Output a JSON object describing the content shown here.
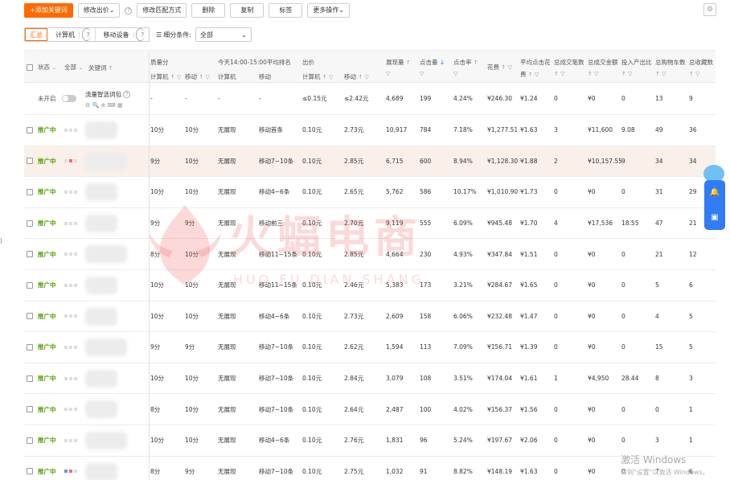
{
  "toolbar": {
    "add_keyword": "+添加关键词",
    "modify_bid": "修改出价",
    "modify_match": "修改匹配方式",
    "delete": "删除",
    "copy": "复制",
    "tag": "标签",
    "more": "更多操作"
  },
  "filters": {
    "segments": [
      "汇总",
      "计算机",
      "移动设备"
    ],
    "filter_label": "细分条件:",
    "filter_value": "全部"
  },
  "headers": {
    "status": "状态",
    "all": "全部",
    "keyword": "关键词",
    "quality_score": "质量分",
    "qs_pc": "计算机",
    "qs_mobile": "移动",
    "avg_rank_title": "今天14:00-15:00平均排名",
    "rank_pc": "计算机",
    "rank_mobile": "移动",
    "bid": "出价",
    "bid_pc": "计算机",
    "bid_mobile": "移动",
    "impressions": "展现量",
    "clicks": "点击量",
    "ctr": "点击率",
    "cost": "花费",
    "avg_cpc_1": "平均点击花",
    "avg_cpc_2": "费",
    "orders": "总成交笔数",
    "gmv": "总成交金额",
    "roi": "投入产出比",
    "cart": "总购物车数",
    "fav": "总收藏数"
  },
  "summary_row": {
    "status": "未开启",
    "keyword": "流量智选词包",
    "qs_pc": "-",
    "qs_mobile": "-",
    "rank_pc": "-",
    "rank_mobile": "-",
    "bid_pc": "≤0.15元",
    "bid_mobile": "≤2.42元",
    "impressions": "4,689",
    "clicks": "199",
    "ctr": "4.24%",
    "cost": "¥246.30",
    "avg_cpc": "¥1.24",
    "orders": "0",
    "gmv": "¥0",
    "roi": "0",
    "cart": "13",
    "fav": "9"
  },
  "rows": [
    {
      "status": "推广中",
      "qs_pc": "10分",
      "qs_mobile": "10分",
      "rank_pc": "无展现",
      "rank_mobile": "移动首条",
      "bid_pc": "0.10元",
      "bid_mobile": "2.73元",
      "impressions": "10,917",
      "clicks": "784",
      "ctr": "7.18%",
      "cost": "¥1,277.51",
      "avg_cpc": "¥1.63",
      "orders": "3",
      "gmv": "¥11,600",
      "roi": "9.08",
      "cart": "49",
      "fav": "36"
    },
    {
      "status": "推广中",
      "qs_pc": "9分",
      "qs_mobile": "10分",
      "rank_pc": "无展现",
      "rank_mobile": "移动7~10条",
      "bid_pc": "0.10元",
      "bid_mobile": "2.85元",
      "impressions": "6,715",
      "clicks": "600",
      "ctr": "8.94%",
      "cost": "¥1,128.30",
      "avg_cpc": "¥1.88",
      "orders": "2",
      "gmv": "¥10,157.55",
      "roi": "9",
      "cart": "34",
      "fav": "34"
    },
    {
      "status": "推广中",
      "qs_pc": "10分",
      "qs_mobile": "10分",
      "rank_pc": "无展现",
      "rank_mobile": "移动4~6条",
      "bid_pc": "0.10元",
      "bid_mobile": "2.65元",
      "impressions": "5,762",
      "clicks": "586",
      "ctr": "10.17%",
      "cost": "¥1,010.90",
      "avg_cpc": "¥1.73",
      "orders": "0",
      "gmv": "¥0",
      "roi": "0",
      "cart": "31",
      "fav": "29"
    },
    {
      "status": "推广中",
      "qs_pc": "9分",
      "qs_mobile": "9分",
      "rank_pc": "无展现",
      "rank_mobile": "移动前三",
      "bid_pc": "0.10元",
      "bid_mobile": "2.70元",
      "impressions": "9,119",
      "clicks": "555",
      "ctr": "6.09%",
      "cost": "¥945.48",
      "avg_cpc": "¥1.70",
      "orders": "4",
      "gmv": "¥17,536",
      "roi": "18.55",
      "cart": "47",
      "fav": "21"
    },
    {
      "status": "推广中",
      "qs_pc": "8分",
      "qs_mobile": "10分",
      "rank_pc": "无展现",
      "rank_mobile": "移动11~15条",
      "bid_pc": "0.10元",
      "bid_mobile": "2.85元",
      "impressions": "4,664",
      "clicks": "230",
      "ctr": "4.93%",
      "cost": "¥347.84",
      "avg_cpc": "¥1.51",
      "orders": "0",
      "gmv": "¥0",
      "roi": "0",
      "cart": "21",
      "fav": "12"
    },
    {
      "status": "推广中",
      "qs_pc": "10分",
      "qs_mobile": "10分",
      "rank_pc": "无展现",
      "rank_mobile": "移动11~15条",
      "bid_pc": "0.10元",
      "bid_mobile": "2.46元",
      "impressions": "5,383",
      "clicks": "173",
      "ctr": "3.21%",
      "cost": "¥284.67",
      "avg_cpc": "¥1.65",
      "orders": "0",
      "gmv": "¥0",
      "roi": "0",
      "cart": "5",
      "fav": "6"
    },
    {
      "status": "推广中",
      "qs_pc": "10分",
      "qs_mobile": "10分",
      "rank_pc": "无展现",
      "rank_mobile": "移动4~6条",
      "bid_pc": "0.10元",
      "bid_mobile": "2.73元",
      "impressions": "2,609",
      "clicks": "158",
      "ctr": "6.06%",
      "cost": "¥232.48",
      "avg_cpc": "¥1.47",
      "orders": "0",
      "gmv": "¥0",
      "roi": "0",
      "cart": "4",
      "fav": "5"
    },
    {
      "status": "推广中",
      "qs_pc": "9分",
      "qs_mobile": "9分",
      "rank_pc": "无展现",
      "rank_mobile": "移动7~10条",
      "bid_pc": "0.10元",
      "bid_mobile": "2.62元",
      "impressions": "1,594",
      "clicks": "113",
      "ctr": "7.09%",
      "cost": "¥156.71",
      "avg_cpc": "¥1.39",
      "orders": "0",
      "gmv": "¥0",
      "roi": "0",
      "cart": "15",
      "fav": "5"
    },
    {
      "status": "推广中",
      "qs_pc": "10分",
      "qs_mobile": "10分",
      "rank_pc": "无展现",
      "rank_mobile": "移动7~10条",
      "bid_pc": "0.10元",
      "bid_mobile": "2.84元",
      "impressions": "3,079",
      "clicks": "108",
      "ctr": "3.51%",
      "cost": "¥174.04",
      "avg_cpc": "¥1.61",
      "orders": "1",
      "gmv": "¥4,950",
      "roi": "28.44",
      "cart": "8",
      "fav": "3"
    },
    {
      "status": "推广中",
      "qs_pc": "8分",
      "qs_mobile": "10分",
      "rank_pc": "无展现",
      "rank_mobile": "移动7~10条",
      "bid_pc": "0.10元",
      "bid_mobile": "2.64元",
      "impressions": "2,487",
      "clicks": "100",
      "ctr": "4.02%",
      "cost": "¥156.37",
      "avg_cpc": "¥1.56",
      "orders": "0",
      "gmv": "¥0",
      "roi": "0",
      "cart": "0",
      "fav": "1"
    },
    {
      "status": "推广中",
      "qs_pc": "10分",
      "qs_mobile": "10分",
      "rank_pc": "无展现",
      "rank_mobile": "移动4~6条",
      "bid_pc": "0.10元",
      "bid_mobile": "2.76元",
      "impressions": "1,831",
      "clicks": "96",
      "ctr": "5.24%",
      "cost": "¥197.67",
      "avg_cpc": "¥2.06",
      "orders": "0",
      "gmv": "¥0",
      "roi": "0",
      "cart": "3",
      "fav": "1"
    },
    {
      "status": "推广中",
      "qs_pc": "8分",
      "qs_mobile": "9分",
      "rank_pc": "无展现",
      "rank_mobile": "移动7~10条",
      "bid_pc": "0.10元",
      "bid_mobile": "2.75元",
      "impressions": "1,032",
      "clicks": "91",
      "ctr": "8.82%",
      "cost": "¥148.19",
      "avg_cpc": "¥1.63",
      "orders": "0",
      "gmv": "¥0",
      "roi": "0",
      "cart": "7",
      "fav": "6"
    }
  ],
  "watermark": {
    "cn": "火蝠电商",
    "en": "HUO FU DIAN SHANG"
  },
  "windows_watermark": {
    "line1": "激活 Windows",
    "line2": "转到\"设置\"以激活 Windows。"
  }
}
